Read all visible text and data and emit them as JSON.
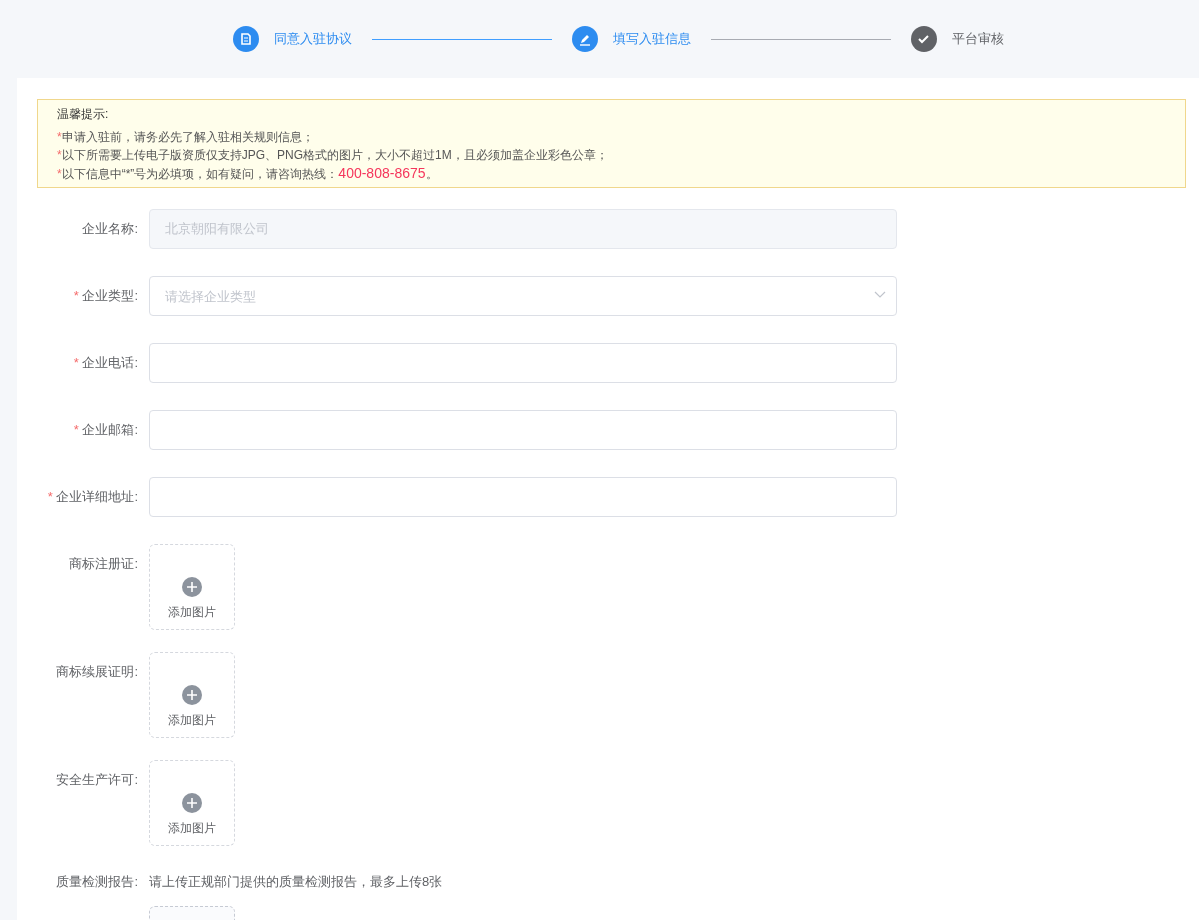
{
  "steps": [
    {
      "label": "同意入驻协议",
      "completed": true,
      "kind": "document"
    },
    {
      "label": "填写入驻信息",
      "completed": true,
      "kind": "edit"
    },
    {
      "label": "平台审核",
      "completed": false,
      "kind": "check"
    }
  ],
  "notice": {
    "title": "温馨提示:",
    "lines": [
      {
        "mark": "*",
        "text": "申请入驻前，请务必先了解入驻相关规则信息；"
      },
      {
        "mark": "*",
        "text": "以下所需要上传电子版资质仅支持JPG、PNG格式的图片，大小不超过1M，且必须加盖企业彩色公章；"
      },
      {
        "mark": "*",
        "text": "以下信息中“*”号为必填项，如有疑问，请咨询热线：",
        "phone": "400-808-8675",
        "end": "。"
      }
    ]
  },
  "fields": [
    {
      "kind": "text",
      "label": "企业名称:",
      "required": false,
      "disabled": true,
      "value": "北京朝阳有限公司"
    },
    {
      "kind": "select",
      "label": "企业类型:",
      "required": true,
      "disabled": false,
      "placeholder": "请选择企业类型"
    },
    {
      "kind": "text",
      "label": "企业电话:",
      "required": true,
      "disabled": false
    },
    {
      "kind": "text",
      "label": "企业邮箱:",
      "required": true,
      "disabled": false
    },
    {
      "kind": "text",
      "label": "企业详细地址:",
      "required": true,
      "disabled": false
    },
    {
      "kind": "upload",
      "label": "商标注册证:",
      "required": false,
      "button": "添加图片"
    },
    {
      "kind": "upload",
      "label": "商标续展证明:",
      "required": false,
      "button": "添加图片"
    },
    {
      "kind": "upload",
      "label": "安全生产许可:",
      "required": false,
      "button": "添加图片"
    },
    {
      "kind": "upload-hint",
      "label": "质量检测报告:",
      "required": false,
      "hint": "请上传正规部门提供的质量检测报告，最多上传8张"
    }
  ]
}
